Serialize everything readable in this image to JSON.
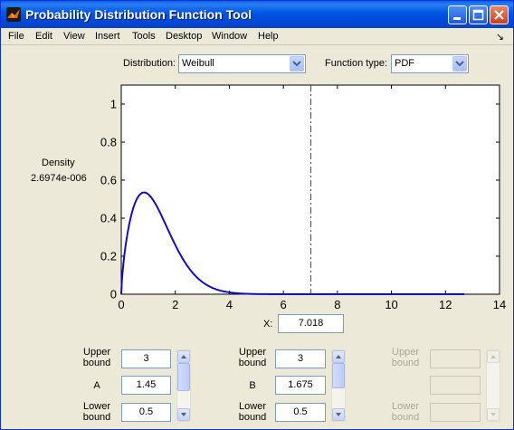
{
  "window": {
    "title": "Probability Distribution Function Tool"
  },
  "menu": [
    "File",
    "Edit",
    "View",
    "Insert",
    "Tools",
    "Desktop",
    "Window",
    "Help"
  ],
  "controls": {
    "distribution_label": "Distribution:",
    "distribution_value": "Weibull",
    "function_type_label": "Function type:",
    "function_type_value": "PDF"
  },
  "readout": {
    "label": "Density",
    "value": "2.6974e-006"
  },
  "x_field": {
    "label": "X:",
    "value": "7.018"
  },
  "params": [
    {
      "name": "A",
      "value": "1.45",
      "upper_label": "Upper bound",
      "upper": "3",
      "lower_label": "Lower bound",
      "lower": "0.5",
      "enabled": true
    },
    {
      "name": "B",
      "value": "1.675",
      "upper_label": "Upper bound",
      "upper": "3",
      "lower_label": "Lower bound",
      "lower": "0.5",
      "enabled": true
    },
    {
      "name": "",
      "value": "",
      "upper_label": "Upper bound",
      "upper": "",
      "lower_label": "Lower bound",
      "lower": "",
      "enabled": false
    }
  ],
  "chart_data": {
    "type": "line",
    "distribution": "Weibull",
    "params": {
      "A": 1.45,
      "B": 1.675
    },
    "xlim": [
      0,
      14
    ],
    "ylim": [
      0,
      1.1
    ],
    "xticks": [
      0,
      2,
      4,
      6,
      8,
      10,
      12,
      14
    ],
    "yticks": [
      0,
      0.2,
      0.4,
      0.6,
      0.8,
      1
    ],
    "xtick_labels": [
      "0",
      "2",
      "4",
      "6",
      "8",
      "10",
      "12",
      "14"
    ],
    "ytick_labels": [
      "0",
      "0.2",
      "0.4",
      "0.6",
      "0.8",
      "1"
    ],
    "x_extent": [
      0,
      12.7
    ],
    "marker_x": 7.018,
    "curve_color": "#1010c0",
    "marker_color": "#c01030",
    "grid": false
  },
  "colors": {
    "titlebar": "#0055e5",
    "face": "#ece9d8"
  }
}
